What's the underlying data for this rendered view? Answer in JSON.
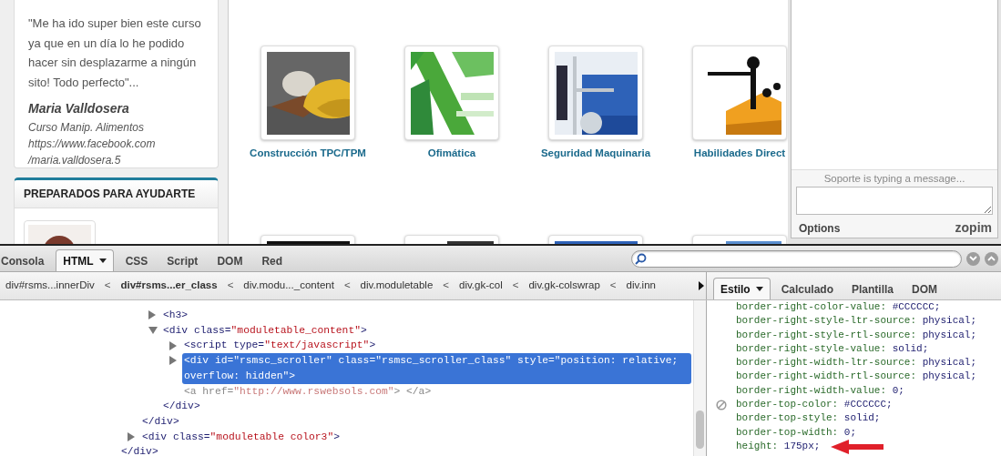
{
  "sidebar": {
    "testimonial": {
      "quote": "\"Me ha ido super bien este curso ya que en un día lo he podido hacer sin desplazarme a ningún sito! Todo perfecto\"...",
      "author": "Maria Valldosera",
      "details": [
        "Curso Manip. Alimentos",
        "https://www.facebook.com",
        "/maria.valldosera.5"
      ]
    },
    "team": {
      "title": "PREPARADOS PARA AYUDARTE"
    }
  },
  "courses": [
    {
      "label": "Construcción TPC/TPM"
    },
    {
      "label": "Ofimática"
    },
    {
      "label": "Seguridad Maquinaria"
    },
    {
      "label": "Habilidades Direct"
    }
  ],
  "chat": {
    "status": "Soporte is typing a message...",
    "options": "Options",
    "brand": "zopim"
  },
  "devtools": {
    "tabs": [
      {
        "label": "Consola",
        "selected": false,
        "menu": false
      },
      {
        "label": "HTML",
        "selected": true,
        "menu": true
      },
      {
        "label": "CSS",
        "selected": false,
        "menu": false
      },
      {
        "label": "Script",
        "selected": false,
        "menu": false
      },
      {
        "label": "DOM",
        "selected": false,
        "menu": false
      },
      {
        "label": "Red",
        "selected": false,
        "menu": false
      }
    ],
    "breadcrumbs": [
      {
        "kind": "crumb",
        "text": "div#rsms...innerDiv",
        "selected": false
      },
      {
        "kind": "separator",
        "text": "<"
      },
      {
        "kind": "crumb",
        "text": "div#rsms...er_class",
        "selected": true
      },
      {
        "kind": "separator",
        "text": "<"
      },
      {
        "kind": "crumb",
        "text": "div.modu..._content",
        "selected": false
      },
      {
        "kind": "separator",
        "text": "<"
      },
      {
        "kind": "crumb",
        "text": "div.moduletable",
        "selected": false
      },
      {
        "kind": "separator",
        "text": "<"
      },
      {
        "kind": "crumb",
        "text": "div.gk-col",
        "selected": false
      },
      {
        "kind": "separator",
        "text": "<"
      },
      {
        "kind": "crumb",
        "text": "div.gk-colswrap",
        "selected": false
      },
      {
        "kind": "separator",
        "text": "<"
      },
      {
        "kind": "crumb",
        "text": "div.inn",
        "selected": false
      }
    ],
    "side_tabs": [
      {
        "label": "Estilo",
        "selected": true,
        "menu": true
      },
      {
        "label": "Calculado",
        "selected": false,
        "menu": false
      },
      {
        "label": "Plantilla",
        "selected": false,
        "menu": false
      },
      {
        "label": "DOM",
        "selected": false,
        "menu": false
      }
    ],
    "tree": [
      {
        "children": [
          {
            "children": [
              {
                "tokens": [
                  {
                    "text": "<h3>",
                    "kind": "markup"
                  }
                ],
                "expandable": true,
                "expanded": false,
                "selected": false,
                "dimmed": false
              },
              {
                "tokens": [
                  {
                    "text": "<div class=",
                    "kind": "markup"
                  },
                  {
                    "text": "\"moduletable_content\"",
                    "kind": "value"
                  },
                  {
                    "text": ">",
                    "kind": "markup"
                  }
                ],
                "expandable": true,
                "expanded": true,
                "selected": false,
                "dimmed": false,
                "children": [
                  {
                    "tokens": [
                      {
                        "text": "<script type=",
                        "kind": "markup"
                      },
                      {
                        "text": "\"text/javascript\"",
                        "kind": "value"
                      },
                      {
                        "text": ">",
                        "kind": "markup"
                      }
                    ],
                    "expandable": true,
                    "expanded": false,
                    "selected": false,
                    "dimmed": false
                  },
                  {
                    "tokens": [
                      {
                        "text": "<div id=",
                        "kind": "markup"
                      },
                      {
                        "text": "\"rsmsc_scroller\"",
                        "kind": "value"
                      },
                      {
                        "text": " class=",
                        "kind": "markup"
                      },
                      {
                        "text": "\"rsmsc_scroller_class\"",
                        "kind": "value"
                      },
                      {
                        "text": " style=",
                        "kind": "markup"
                      },
                      {
                        "text": "\"position: relative; overflow: hidden\"",
                        "kind": "value"
                      },
                      {
                        "text": ">",
                        "kind": "markup"
                      }
                    ],
                    "expandable": true,
                    "expanded": false,
                    "selected": true,
                    "dimmed": false
                  },
                  {
                    "tokens": [
                      {
                        "text": "<a href=",
                        "kind": "markup"
                      },
                      {
                        "text": "\"http://www.rswebsols.com\"",
                        "kind": "value"
                      },
                      {
                        "text": "> </a>",
                        "kind": "markup"
                      }
                    ],
                    "expandable": false,
                    "selected": false,
                    "dimmed": true
                  }
                ],
                "closing": [
                  {
                    "text": "</div>",
                    "kind": "markup"
                  }
                ]
              }
            ],
            "closing": [
              {
                "text": "</div>",
                "kind": "markup"
              }
            ]
          },
          {
            "tokens": [
              {
                "text": "<div class=",
                "kind": "markup"
              },
              {
                "text": "\"moduletable color3\"",
                "kind": "value"
              },
              {
                "text": ">",
                "kind": "markup"
              }
            ],
            "expandable": true,
            "expanded": false,
            "selected": false,
            "dimmed": false
          }
        ],
        "closing": [
          {
            "text": "</div>",
            "kind": "markup"
          }
        ]
      }
    ],
    "style_rules": [
      {
        "property": "border-right-color-value:",
        "value": "#CCCCCC;",
        "disabled": false,
        "annotated": false
      },
      {
        "property": "border-right-style-ltr-source:",
        "value": "physical;",
        "disabled": false,
        "annotated": false
      },
      {
        "property": "border-right-style-rtl-source:",
        "value": "physical;",
        "disabled": false,
        "annotated": false
      },
      {
        "property": "border-right-style-value:",
        "value": "solid;",
        "disabled": false,
        "annotated": false
      },
      {
        "property": "border-right-width-ltr-source:",
        "value": "physical;",
        "disabled": false,
        "annotated": false
      },
      {
        "property": "border-right-width-rtl-source:",
        "value": "physical;",
        "disabled": false,
        "annotated": false
      },
      {
        "property": "border-right-width-value:",
        "value": "0;",
        "disabled": false,
        "annotated": false
      },
      {
        "property": "border-top-color:",
        "value": "#CCCCCC;",
        "disabled": true,
        "annotated": false
      },
      {
        "property": "border-top-style:",
        "value": "solid;",
        "disabled": false,
        "annotated": false
      },
      {
        "property": "border-top-width:",
        "value": "0;",
        "disabled": false,
        "annotated": false
      },
      {
        "property": "height:",
        "value": "175px;",
        "disabled": false,
        "annotated": true
      }
    ]
  }
}
